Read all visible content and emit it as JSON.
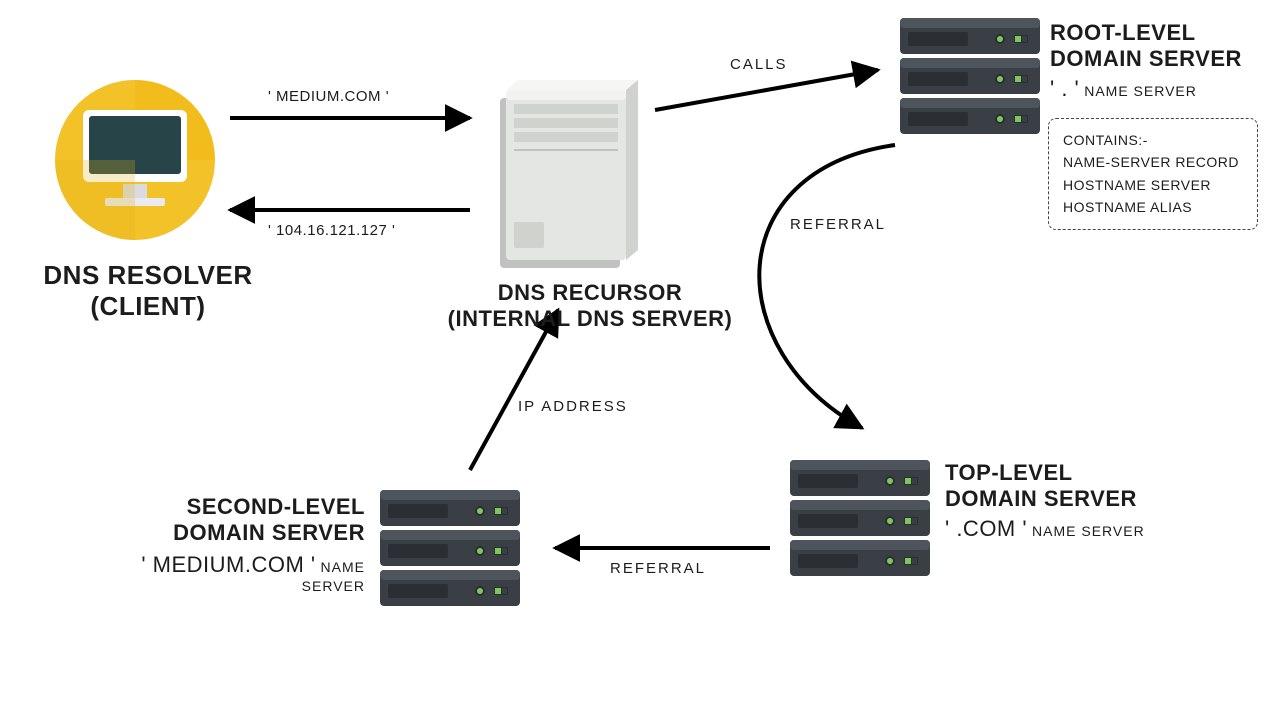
{
  "nodes": {
    "client": {
      "title_line1": "DNS RESOLVER",
      "title_line2": "(CLIENT)"
    },
    "recursor": {
      "title_line1": "DNS RECURSOR",
      "title_line2": "(INTERNAL DNS SERVER)"
    },
    "root": {
      "title_line1": "ROOT-LEVEL",
      "title_line2": "DOMAIN SERVER",
      "namespace": "'  .  '",
      "ns_suffix": "NAME SERVER"
    },
    "tld": {
      "title_line1": "TOP-LEVEL",
      "title_line2": "DOMAIN SERVER",
      "namespace": "' .COM '",
      "ns_suffix": "NAME SERVER"
    },
    "sld": {
      "title_line1": "SECOND-LEVEL",
      "title_line2": "DOMAIN SERVER",
      "namespace": "' MEDIUM.COM '",
      "ns_suffix": "NAME SERVER"
    }
  },
  "edges": {
    "client_to_recursor_query": "' MEDIUM.COM '",
    "recursor_to_client_answer": "' 104.16.121.127 '",
    "recursor_to_root": "CALLS",
    "root_to_tld": "REFERRAL",
    "tld_to_sld": "REFERRAL",
    "sld_to_recursor": "IP ADDRESS"
  },
  "root_contains": {
    "heading": "CONTAINS:-",
    "lines": [
      "NAME-SERVER RECORD",
      "HOSTNAME SERVER",
      "HOSTNAME ALIAS"
    ]
  },
  "colors": {
    "accent_yellow": "#f3c229",
    "server_dark": "#3a3f45",
    "server_mid": "#4e545b",
    "led_green": "#7cc95a",
    "monitor_teal": "#274548",
    "recursor_light": "#e4e6e3",
    "recursor_shadow": "#bfc2be"
  }
}
